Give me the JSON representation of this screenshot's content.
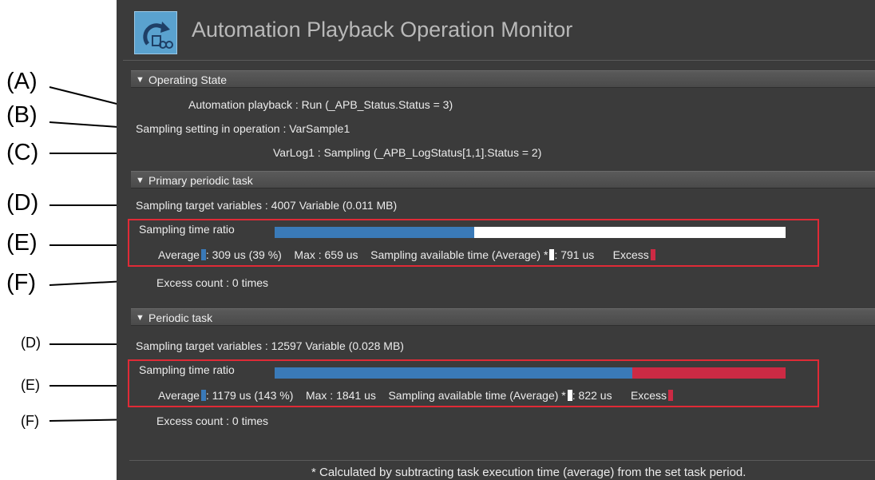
{
  "window": {
    "title": "Automation Playback Operation Monitor"
  },
  "callouts": {
    "A": "(A)",
    "B": "(B)",
    "C": "(C)",
    "D1": "(D)",
    "E1": "(E)",
    "F1": "(F)",
    "D2": "(D)",
    "E2": "(E)",
    "F2": "(F)"
  },
  "operating_state": {
    "header": "Operating State",
    "automation_playback_label": "Automation playback",
    "automation_playback_value": "Run (_APB_Status.Status = 3)",
    "sampling_setting_label": "Sampling setting in operation",
    "sampling_setting_value": "VarSample1",
    "varlog_label": "VarLog1",
    "varlog_value": "Sampling (_APB_LogStatus[1,1].Status = 2)"
  },
  "primary_task": {
    "header": "Primary periodic task",
    "target_label": "Sampling target variables",
    "target_value": "4007 Variable  (0.011 MB)",
    "ratio_label": "Sampling time ratio",
    "average_fraction": 0.39,
    "available_fraction": 0.61,
    "excess_fraction": 0,
    "average_label": "Average",
    "average_value": ": 309 us (39 %)",
    "max_value": "Max : 659 us",
    "available_label": "Sampling available time (Average) *",
    "available_value": ": 791 us",
    "excess_label": "Excess",
    "excess_count": "Excess count : 0 times"
  },
  "periodic_task": {
    "header": "Periodic task",
    "target_label": "Sampling target variables",
    "target_value": "12597 Variable  (0.028 MB)",
    "ratio_label": "Sampling time ratio",
    "average_fraction": 0.7,
    "available_fraction": 0,
    "excess_fraction": 0.3,
    "average_label": "Average",
    "average_value": ": 1179 us (143 %)",
    "max_value": "Max : 1841 us",
    "available_label": "Sampling available time (Average) *",
    "available_value": ": 822 us",
    "excess_label": "Excess",
    "excess_count": "Excess count : 0 times"
  },
  "footer": {
    "note": "* Calculated by subtracting task execution time (average) from the set task period."
  },
  "colors": {
    "average": "#3a7ab8",
    "available": "#ffffff",
    "excess": "#cc2a44",
    "highlight_box": "#e02a36"
  }
}
